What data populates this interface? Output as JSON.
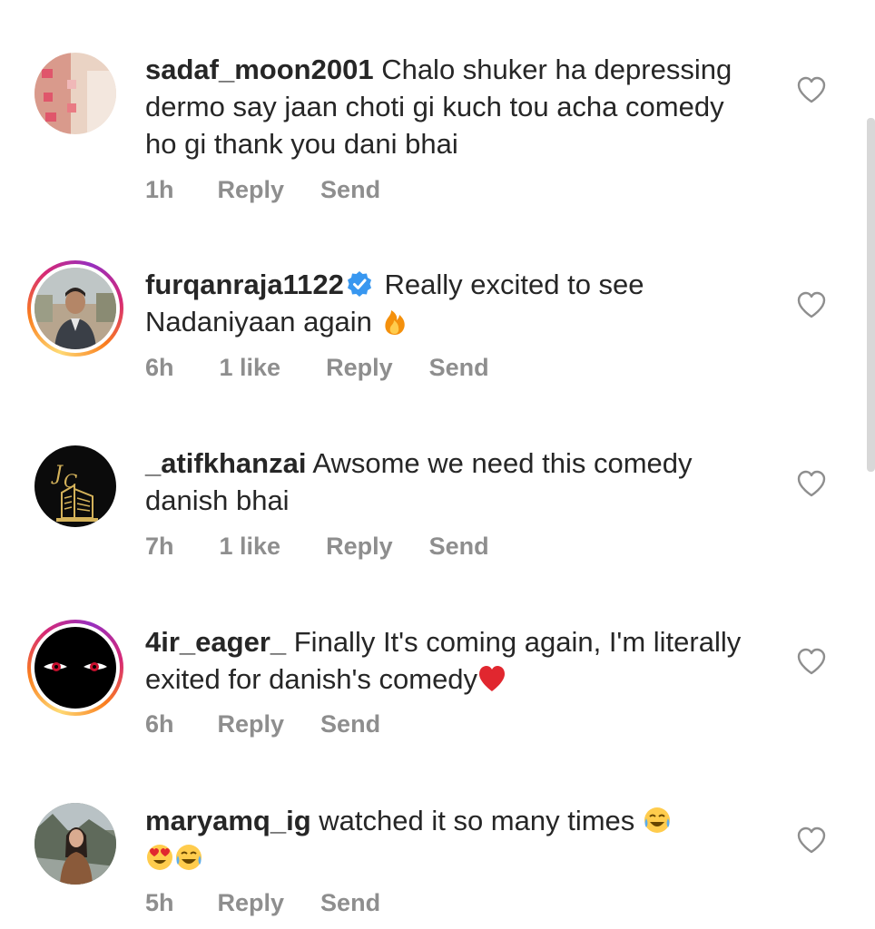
{
  "comments": [
    {
      "username": "sadaf_moon2001",
      "verified": false,
      "text": "Chalo shuker ha depressing  dermo say jaan choti gi kuch tou acha comedy  ho gi thank you dani bhai",
      "time": "1h",
      "likes": "",
      "reply_label": "Reply",
      "send_label": "Send",
      "avatar": "pink-wall-avatar",
      "story_ring": false
    },
    {
      "username": "furqanraja1122",
      "verified": true,
      "text": "Really excited to see Nadaniyaan again",
      "emoji": [
        "fire"
      ],
      "time": "6h",
      "likes": "1 like",
      "reply_label": "Reply",
      "send_label": "Send",
      "avatar": "man-portrait-avatar",
      "story_ring": true
    },
    {
      "username": "_atifkhanzai",
      "verified": false,
      "text": "Awsome we need this comedy danish bhai",
      "time": "7h",
      "likes": "1 like",
      "reply_label": "Reply",
      "send_label": "Send",
      "avatar": "gold-logo-avatar",
      "story_ring": false
    },
    {
      "username": "4ir_eager_",
      "verified": false,
      "text": "Finally It's coming again, I'm literally exited for danish's comedy",
      "emoji": [
        "red-heart"
      ],
      "time": "6h",
      "likes": "",
      "reply_label": "Reply",
      "send_label": "Send",
      "avatar": "red-eyes-avatar",
      "story_ring": true
    },
    {
      "username": "maryamq_ig",
      "verified": false,
      "text": "watched it so many times",
      "emoji": [
        "tears-of-joy",
        "heart-eyes",
        "tears-of-joy"
      ],
      "time": "5h",
      "likes": "",
      "reply_label": "Reply",
      "send_label": "Send",
      "avatar": "woman-portrait-avatar",
      "story_ring": false
    }
  ],
  "icons": {
    "like": "heart-outline-icon",
    "verified": "verified-badge-icon"
  },
  "colors": {
    "text": "#262626",
    "meta": "#8e8e8e",
    "verified": "#3897f0"
  }
}
